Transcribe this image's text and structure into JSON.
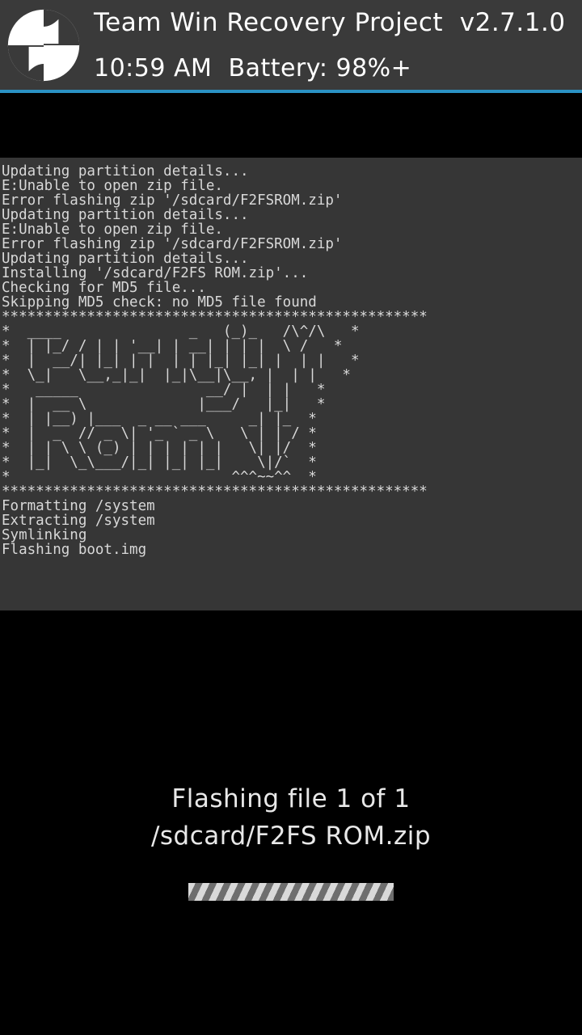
{
  "header": {
    "title": "Team Win Recovery Project",
    "version_prefix": "v",
    "version": "2.7.1.0",
    "time": "10:59 AM",
    "battery_label": "Battery:",
    "battery_value": "98%+"
  },
  "console": {
    "lines": [
      "Updating partition details...",
      "E:Unable to open zip file.",
      "Error flashing zip '/sdcard/F2FSROM.zip'",
      "Updating partition details...",
      "E:Unable to open zip file.",
      "Error flashing zip '/sdcard/F2FSROM.zip'",
      "Updating partition details...",
      "Installing '/sdcard/F2FS ROM.zip'...",
      "Checking for MD5 file...",
      "Skipping MD5 check: no MD5 file found",
      "**************************************************",
      "*  ____               _   (_)_   /\\^/\\   *",
      "*  | |_/ / | | '__| | __| | | |  \\ /   *",
      "*  |  __/| |_| | |  | | |_| |_| |  | |   *",
      "*  \\_|   \\__,_|_|  |_|\\__|\\__, |  | |   *",
      "*   _____               __/ |  | |   *",
      "*  |  __ \\             |___/   |_|   *",
      "*  | |__) |___  _ __ ___     _| |_  *",
      "*  |  _  // _ \\| '_ ` _ \\   \\ | | / *",
      "*  | | \\ \\ (_) | | | | | |   \\| |/  *",
      "*  |_|  \\_\\___/|_| |_| |_|    \\|/`  *",
      "*                          ^^^~~^^  *",
      "**************************************************",
      "Formatting /system",
      "Extracting /system",
      "Symlinking",
      "Flashing boot.img"
    ]
  },
  "status": {
    "line1": "Flashing file 1 of 1",
    "line2": "/sdcard/F2FS ROM.zip"
  }
}
